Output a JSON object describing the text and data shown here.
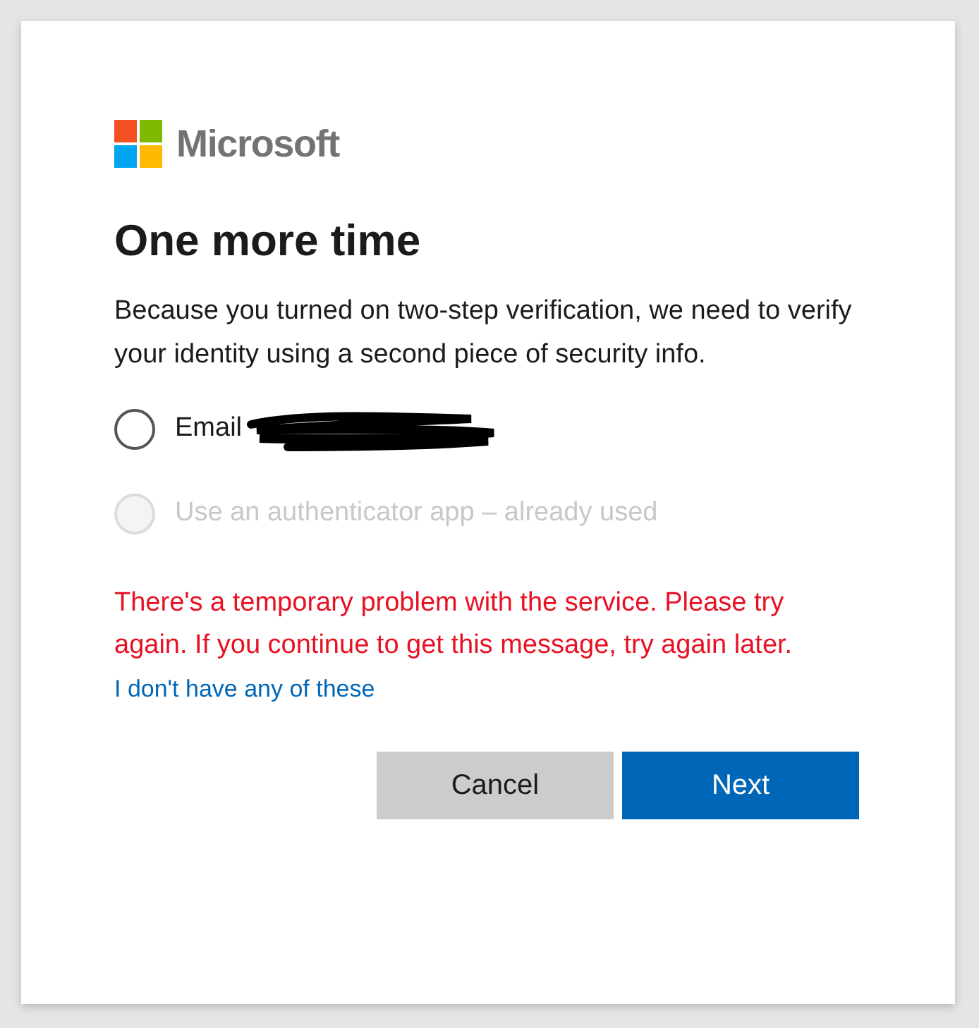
{
  "logo": {
    "text": "Microsoft"
  },
  "title": "One more time",
  "description": "Because you turned on two-step verification, we need to verify your identity using a second piece of security info.",
  "options": [
    {
      "label": "Email",
      "selected": false,
      "disabled": false,
      "redacted": true
    },
    {
      "label": "Use an authenticator app – already used",
      "selected": false,
      "disabled": true,
      "redacted": false
    }
  ],
  "error": "There's a temporary problem with the service. Please try again. If you continue to get this message, try again later.",
  "link": "I don't have any of these",
  "buttons": [
    {
      "label": "Cancel",
      "kind": "secondary"
    },
    {
      "label": "Next",
      "kind": "primary"
    }
  ]
}
